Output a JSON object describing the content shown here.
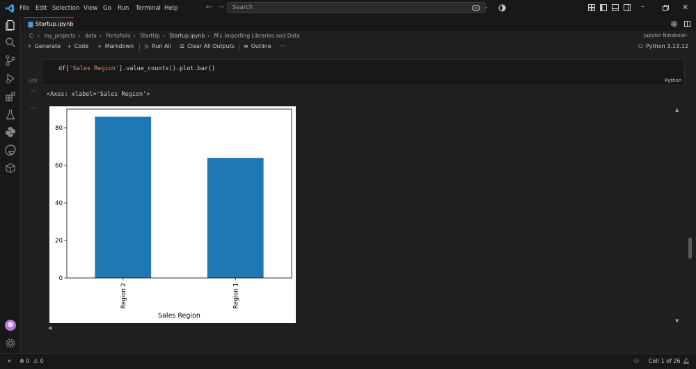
{
  "menu": [
    "File",
    "Edit",
    "Selection",
    "View",
    "Go",
    "Run",
    "Terminal",
    "Help"
  ],
  "search": {
    "placeholder": "Search"
  },
  "tab": {
    "label": "Startup.ipynb"
  },
  "breadcrumb": [
    "C:",
    "my_projects",
    "data",
    "Portofoilo",
    "StartUp",
    "Startup.ipynb",
    "M↓ Importing Libraries and Data"
  ],
  "kernel_type": "Jupyter Notebook",
  "toolbar": {
    "generate": "Generate",
    "code": "Code",
    "markdown": "Markdown",
    "run_all": "Run All",
    "clear_all": "Clear All Outputs",
    "outline": "Outline",
    "more": "···",
    "kernel": "Python 3.13.12"
  },
  "cell": {
    "execution_count": "[20]",
    "code_prefix": "df[",
    "code_string": "'Sales Region'",
    "code_suffix": "].value_counts().plot.bar()",
    "language": "Python"
  },
  "output": {
    "axes_text": "<Axes: xlabel='Sales Region'>"
  },
  "chart_data": {
    "type": "bar",
    "categories": [
      "Region 2",
      "Region 1"
    ],
    "values": [
      86,
      64
    ],
    "xlabel": "Sales Region",
    "ylabel": "",
    "ylim": [
      0,
      90
    ],
    "yticks": [
      0,
      20,
      40,
      60,
      80
    ],
    "bar_color": "#1f77b4",
    "grid": false
  },
  "statusbar": {
    "errors": "0",
    "warnings": "0",
    "cell_position": "Cell 1 of 26"
  },
  "colors": {
    "accent": "#0078d4",
    "string": "#ce9178"
  }
}
